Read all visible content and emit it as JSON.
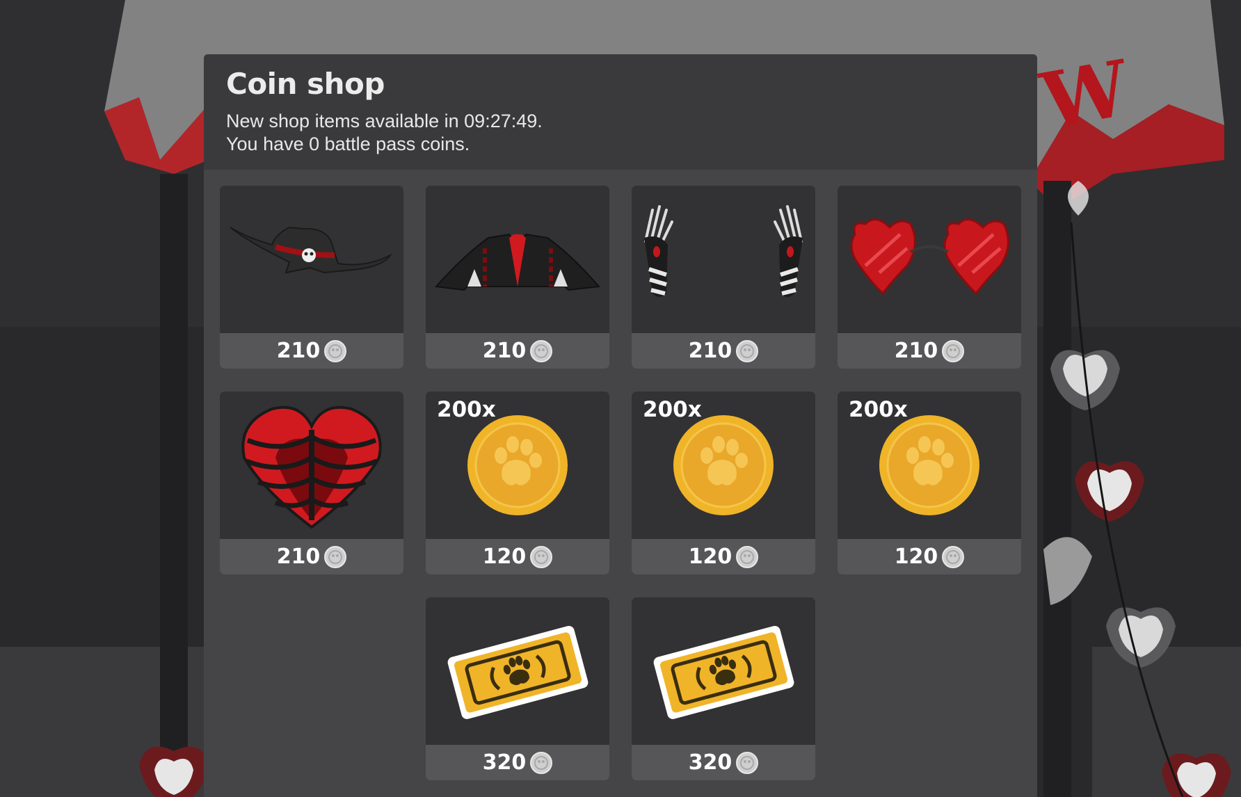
{
  "shop": {
    "title": "Coin shop",
    "timer_line": "New shop items available in 09:27:49.",
    "coins_line": "You have 0 battle pass coins."
  },
  "currency_icon": "battle-pass-coin-icon",
  "colors": {
    "panel": "#454547",
    "header": "#3a3a3c",
    "card": "#323234",
    "price_bar": "#565658",
    "accent_red": "#c8181e",
    "gold": "#f0b429"
  },
  "items": [
    {
      "name": "black-hat",
      "icon": "skull-hat-icon",
      "price": "210"
    },
    {
      "name": "black-jacket",
      "icon": "jacket-icon",
      "price": "210"
    },
    {
      "name": "skeleton-gloves",
      "icon": "gloves-icon",
      "price": "210"
    },
    {
      "name": "heart-glasses",
      "icon": "heart-glasses-icon",
      "price": "210"
    },
    {
      "name": "ribcage-heart",
      "icon": "ribcage-heart-icon",
      "price": "210"
    },
    {
      "name": "paw-coins-1",
      "icon": "paw-coin-icon",
      "quantity": "200x",
      "price": "120"
    },
    {
      "name": "paw-coins-2",
      "icon": "paw-coin-icon",
      "quantity": "200x",
      "price": "120"
    },
    {
      "name": "paw-coins-3",
      "icon": "paw-coin-icon",
      "quantity": "200x",
      "price": "120"
    },
    {
      "name": "paw-ticket-1",
      "icon": "paw-ticket-icon",
      "price": "320"
    },
    {
      "name": "paw-ticket-2",
      "icon": "paw-ticket-icon",
      "price": "320"
    }
  ]
}
